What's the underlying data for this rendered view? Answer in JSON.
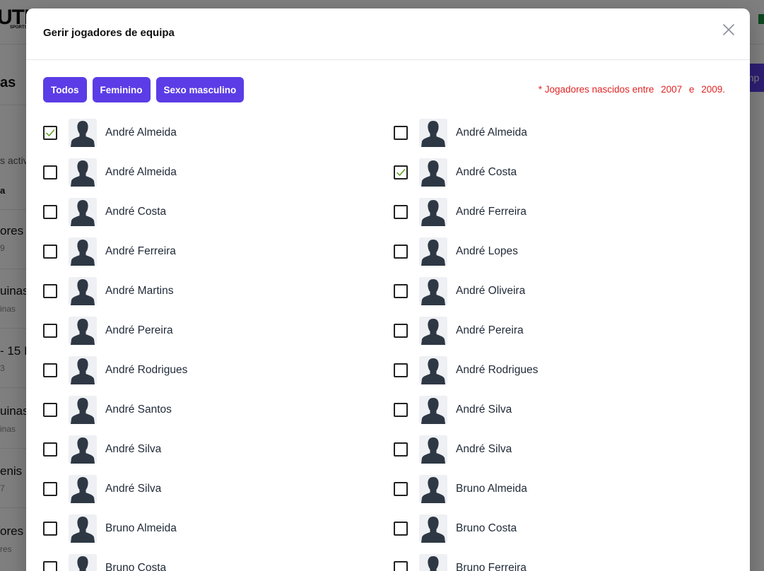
{
  "background": {
    "logo": "UTH",
    "logo_sub": "SPORTS H",
    "heading": "as",
    "import_label": "Imp",
    "items": [
      {
        "text": "s activ"
      },
      {
        "text": "a"
      },
      {
        "text": "ores",
        "sub": "9"
      },
      {
        "text": "uinas",
        "sub": "inas"
      },
      {
        "text": "- 15 I",
        "sub": "3"
      },
      {
        "text": "uinas",
        "sub": "inas"
      },
      {
        "text": "enis B",
        "sub": "7"
      },
      {
        "text": "ores",
        "sub": "res"
      }
    ]
  },
  "modal": {
    "title": "Gerir jogadores de equipa",
    "close_icon": "close-icon",
    "filters": [
      {
        "label": "Todos"
      },
      {
        "label": "Feminino"
      },
      {
        "label": "Sexo masculino"
      }
    ],
    "birth_note": {
      "prefix": "* Jogadores nascidos entre",
      "from": "2007",
      "connector": "e",
      "to": "2009."
    },
    "check_color": "#5aa01e",
    "accent_color": "#5b3ce6",
    "note_color": "#e02424",
    "players": [
      {
        "name": "André Almeida",
        "checked": true
      },
      {
        "name": "André Almeida",
        "checked": false
      },
      {
        "name": "André Almeida",
        "checked": false
      },
      {
        "name": "André Costa",
        "checked": true
      },
      {
        "name": "André Costa",
        "checked": false
      },
      {
        "name": "André Ferreira",
        "checked": false
      },
      {
        "name": "André Ferreira",
        "checked": false
      },
      {
        "name": "André Lopes",
        "checked": false
      },
      {
        "name": "André Martins",
        "checked": false
      },
      {
        "name": "André Oliveira",
        "checked": false
      },
      {
        "name": "André Pereira",
        "checked": false
      },
      {
        "name": "André Pereira",
        "checked": false
      },
      {
        "name": "André Rodrigues",
        "checked": false
      },
      {
        "name": "André Rodrigues",
        "checked": false
      },
      {
        "name": "André Santos",
        "checked": false
      },
      {
        "name": "André Silva",
        "checked": false
      },
      {
        "name": "André Silva",
        "checked": false
      },
      {
        "name": "André Silva",
        "checked": false
      },
      {
        "name": "André Silva",
        "checked": false
      },
      {
        "name": "Bruno Almeida",
        "checked": false
      },
      {
        "name": "Bruno Almeida",
        "checked": false
      },
      {
        "name": "Bruno Costa",
        "checked": false
      },
      {
        "name": "Bruno Costa",
        "checked": false
      },
      {
        "name": "Bruno Ferreira",
        "checked": false
      }
    ]
  }
}
